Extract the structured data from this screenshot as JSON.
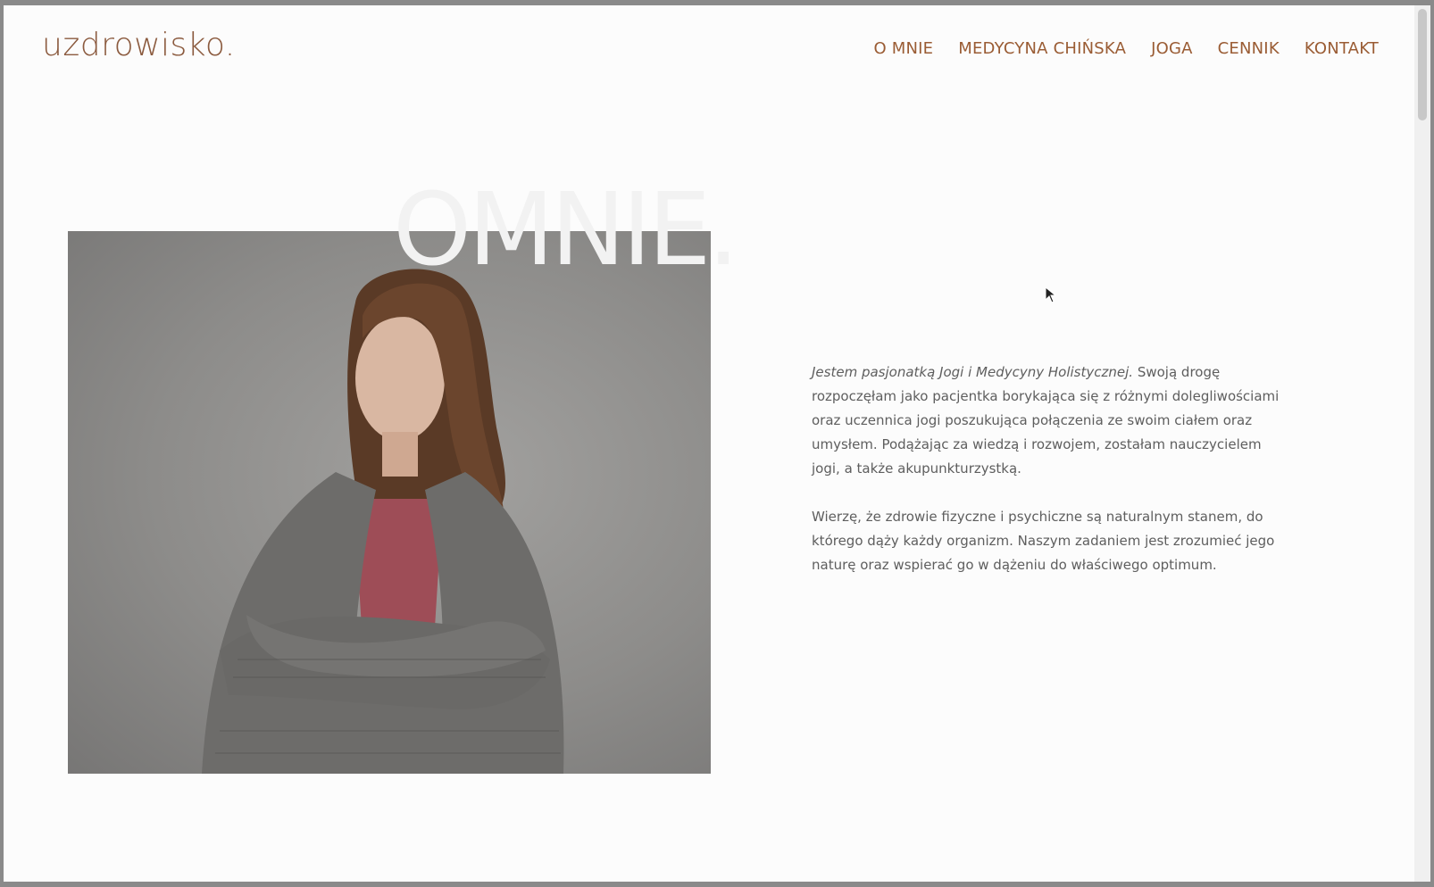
{
  "header": {
    "logo": "uzdrowisko.",
    "nav": [
      {
        "label": "O MNIE"
      },
      {
        "label": "MEDYCYNA CHIŃSKA"
      },
      {
        "label": "JOGA"
      },
      {
        "label": "CENNIK"
      },
      {
        "label": "KONTAKT"
      }
    ]
  },
  "hero": {
    "title": "OMNIE."
  },
  "bio": {
    "intro_italic": "Jestem pasjonatką Jogi i Medycyny Holistycznej.",
    "intro_rest": " Swoją drogę rozpoczęłam jako pacjentka borykająca się z różnymi dolegliwościami oraz uczennica jogi poszukująca połączenia ze swoim ciałem oraz umysłem. Podążając za wiedzą i rozwojem, zostałam nauczycielem jogi, a także akupunkturzystką.",
    "paragraph2": "Wierzę, że zdrowie fizyczne i psychiczne są naturalnym stanem, do którego dąży każdy organizm. Naszym zadaniem jest zrozumieć jego naturę oraz wspierać go w dążeniu do właściwego optimum."
  },
  "colors": {
    "accent": "#9a5c34",
    "background": "#fcfcfc",
    "text": "#5e5e5e"
  }
}
